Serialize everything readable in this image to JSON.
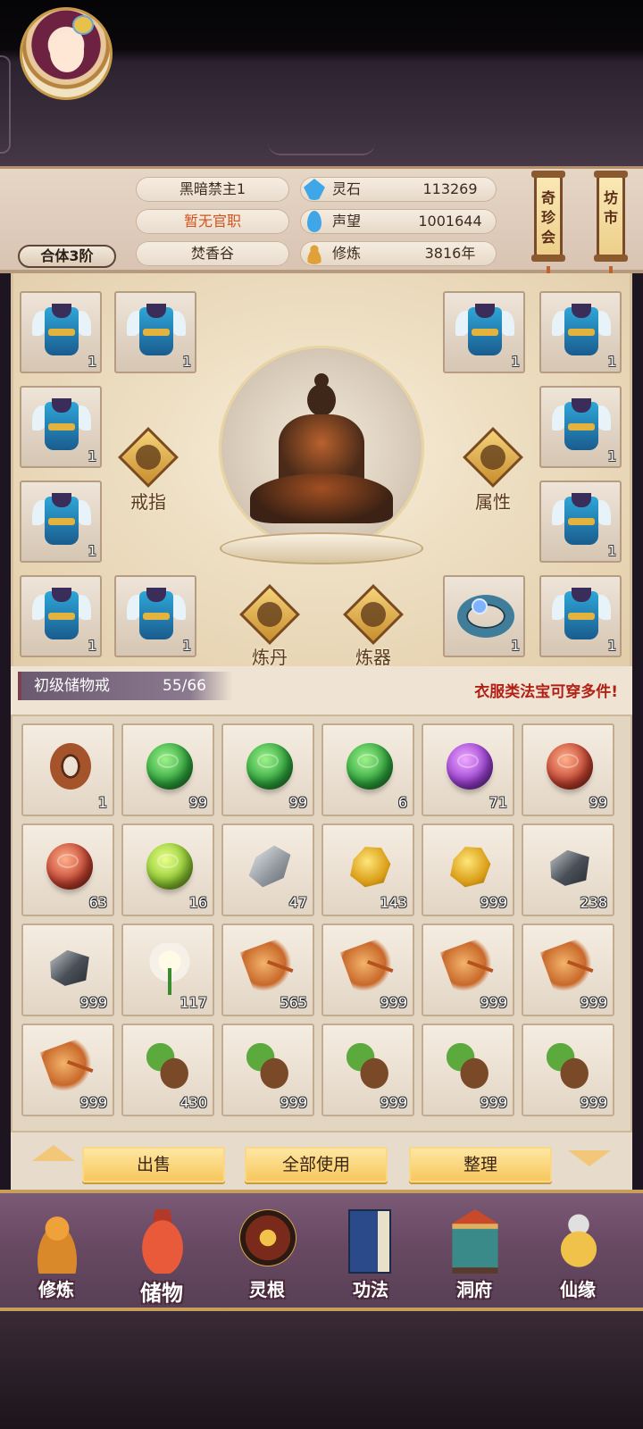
{
  "player": {
    "realm": "合体3阶",
    "name": "黑暗禁主1",
    "title": "暂无官职",
    "sect": "焚香谷"
  },
  "resources": [
    {
      "label": "灵石",
      "value": "113269",
      "icon": "spirit-stone-icon",
      "color": "#3fa7e8"
    },
    {
      "label": "声望",
      "value": "1001644",
      "icon": "prestige-icon",
      "color": "#3fa7e8"
    },
    {
      "label": "修炼",
      "value": "3816年",
      "icon": "meditation-icon",
      "color": "#e0a13a"
    }
  ],
  "side_buttons": [
    {
      "label": "奇珍会"
    },
    {
      "label": "坊市"
    }
  ],
  "equipment": {
    "slots_left": [
      {
        "count": "1"
      },
      {
        "count": "1"
      },
      {
        "count": "1"
      },
      {
        "count": "1"
      },
      {
        "count": "1"
      },
      {
        "count": "1"
      }
    ],
    "slots_right": [
      {
        "count": "1"
      },
      {
        "count": "1"
      },
      {
        "count": "1"
      },
      {
        "count": "1"
      },
      {
        "count": "1"
      },
      {
        "count": "1"
      }
    ],
    "buttons": {
      "ring": "戒指",
      "attributes": "属性",
      "alchemy": "炼丹",
      "forging": "炼器"
    }
  },
  "storage": {
    "name": "初级储物戒",
    "capacity": "55/66",
    "note": "衣服类法宝可穿多件!"
  },
  "inventory": [
    {
      "item": "ring",
      "count": "1"
    },
    {
      "item": "orb-green",
      "count": "99"
    },
    {
      "item": "orb-green",
      "count": "99"
    },
    {
      "item": "orb-green",
      "count": "6"
    },
    {
      "item": "orb-purple",
      "count": "71"
    },
    {
      "item": "orb-red",
      "count": "99"
    },
    {
      "item": "orb-red",
      "count": "63"
    },
    {
      "item": "orb-lime",
      "count": "16"
    },
    {
      "item": "ore-silver",
      "count": "47"
    },
    {
      "item": "ore-gold",
      "count": "143"
    },
    {
      "item": "ore-gold",
      "count": "999"
    },
    {
      "item": "ore-dark",
      "count": "238"
    },
    {
      "item": "ore-dark",
      "count": "999"
    },
    {
      "item": "lily",
      "count": "117"
    },
    {
      "item": "root",
      "count": "565"
    },
    {
      "item": "root",
      "count": "999"
    },
    {
      "item": "root",
      "count": "999"
    },
    {
      "item": "root",
      "count": "999"
    },
    {
      "item": "root",
      "count": "999"
    },
    {
      "item": "herb",
      "count": "430"
    },
    {
      "item": "herb",
      "count": "999"
    },
    {
      "item": "herb",
      "count": "999"
    },
    {
      "item": "herb",
      "count": "999"
    },
    {
      "item": "herb",
      "count": "999"
    }
  ],
  "actions": {
    "sell": "出售",
    "use_all": "全部使用",
    "sort": "整理"
  },
  "nav": [
    {
      "label": "修炼",
      "icon": "cultivate-icon"
    },
    {
      "label": "储物",
      "icon": "storage-bag-icon",
      "active": true
    },
    {
      "label": "灵根",
      "icon": "spirit-root-icon"
    },
    {
      "label": "功法",
      "icon": "technique-book-icon"
    },
    {
      "label": "洞府",
      "icon": "cave-abode-icon"
    },
    {
      "label": "仙缘",
      "icon": "immortal-fate-icon"
    }
  ]
}
